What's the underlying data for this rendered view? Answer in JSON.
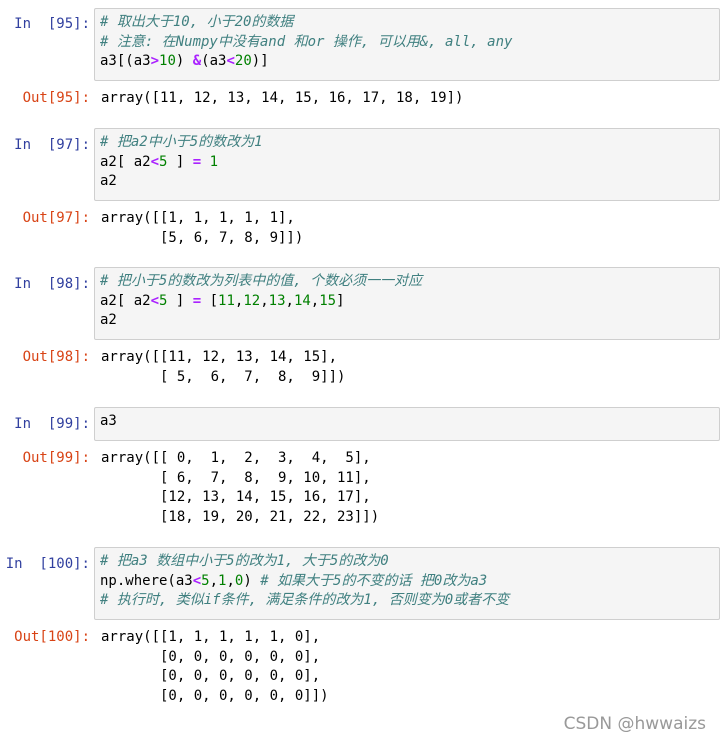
{
  "cells": [
    {
      "in_prompt": "In  [95]:",
      "code": [
        "# 取出大于10, 小于20的数据",
        "# 注意: 在Numpy中没有and 和or 操作, 可以用&, all, any",
        "a3[(a3>10) &(a3<20)]"
      ],
      "out_prompt": "Out[95]:",
      "output": [
        "array([11, 12, 13, 14, 15, 16, 17, 18, 19])"
      ]
    },
    {
      "in_prompt": "In  [97]:",
      "code": [
        "# 把a2中小于5的数改为1",
        "a2[ a2<5 ] = 1",
        "a2"
      ],
      "out_prompt": "Out[97]:",
      "output": [
        "array([[1, 1, 1, 1, 1],",
        "       [5, 6, 7, 8, 9]])"
      ]
    },
    {
      "in_prompt": "In  [98]:",
      "code": [
        "# 把小于5的数改为列表中的值, 个数必须一一对应",
        "a2[ a2<5 ] = [11,12,13,14,15]",
        "a2"
      ],
      "out_prompt": "Out[98]:",
      "output": [
        "array([[11, 12, 13, 14, 15],",
        "       [ 5,  6,  7,  8,  9]])"
      ]
    },
    {
      "in_prompt": "In  [99]:",
      "code": [
        "a3"
      ],
      "out_prompt": "Out[99]:",
      "output": [
        "array([[ 0,  1,  2,  3,  4,  5],",
        "       [ 6,  7,  8,  9, 10, 11],",
        "       [12, 13, 14, 15, 16, 17],",
        "       [18, 19, 20, 21, 22, 23]])"
      ]
    },
    {
      "in_prompt": "In  [100]:",
      "code": [
        "# 把a3 数组中小于5的改为1, 大于5的改为0",
        "np.where(a3<5,1,0) # 如果大于5的不变的话 把0改为a3",
        "# 执行时, 类似if条件, 满足条件的改为1, 否则变为0或者不变"
      ],
      "out_prompt": "Out[100]:",
      "output": [
        "array([[1, 1, 1, 1, 1, 0],",
        "       [0, 0, 0, 0, 0, 0],",
        "       [0, 0, 0, 0, 0, 0],",
        "       [0, 0, 0, 0, 0, 0]])"
      ]
    }
  ],
  "watermark": "CSDN @hwwaizs",
  "colors": {
    "in_prompt": "#303f9f",
    "out_prompt": "#d84315",
    "comment": "#408080",
    "number": "#008000",
    "operator": "#aa22ff"
  }
}
